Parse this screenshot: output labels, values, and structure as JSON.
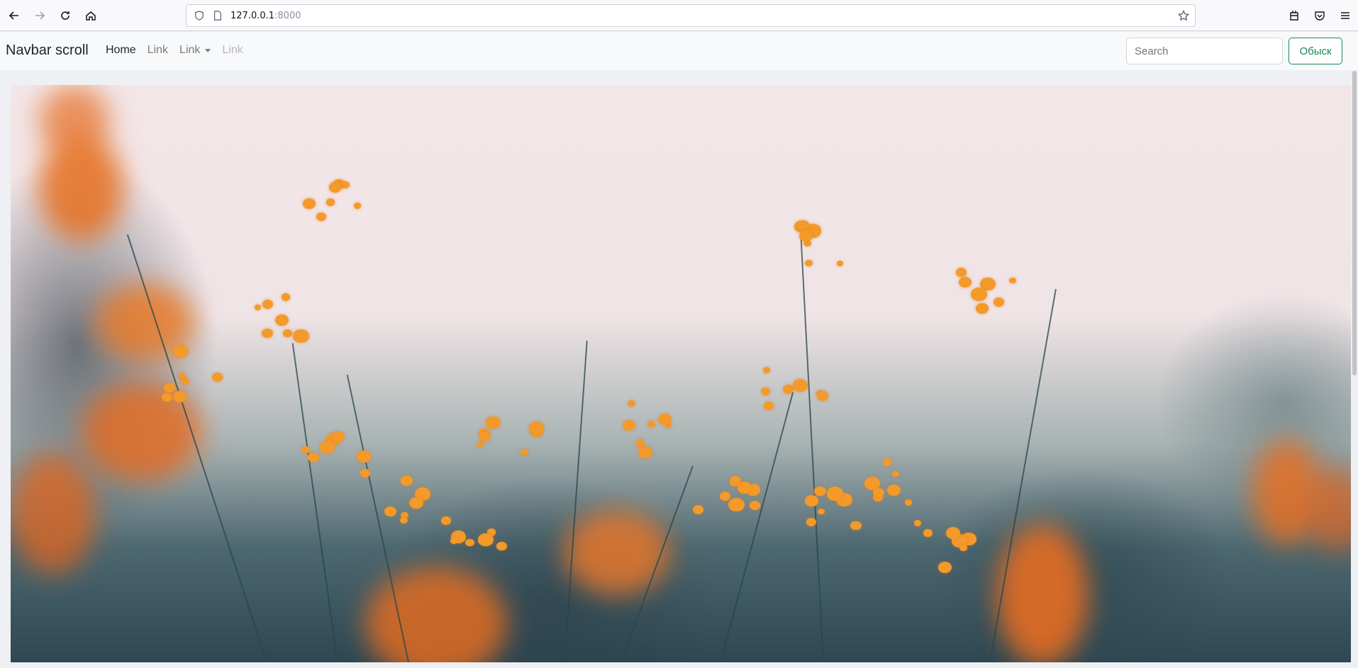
{
  "browser": {
    "url_host": "127.0.0.1",
    "url_port": ":8000"
  },
  "navbar": {
    "brand": "Navbar scroll",
    "links": [
      "Home",
      "Link",
      "Link",
      "Link"
    ],
    "search_placeholder": "Search",
    "search_button": "Обыск"
  },
  "colors": {
    "success": "#198754",
    "navbar_bg": "#f8f9fa",
    "flower_orange": "#f39a2a"
  }
}
